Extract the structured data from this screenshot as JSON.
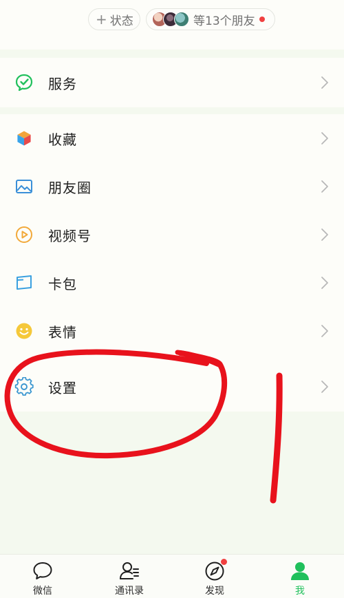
{
  "header": {
    "status_button": {
      "label": "状态"
    },
    "friends_pill": {
      "label": "等13个朋友"
    }
  },
  "menu": {
    "service": {
      "label": "服务",
      "icon": "service-icon"
    },
    "items": [
      {
        "label": "收藏",
        "icon": "favorites-cube-icon"
      },
      {
        "label": "朋友圈",
        "icon": "moments-image-icon"
      },
      {
        "label": "视频号",
        "icon": "channels-play-icon"
      },
      {
        "label": "卡包",
        "icon": "card-wallet-icon"
      },
      {
        "label": "表情",
        "icon": "emoji-smile-icon"
      },
      {
        "label": "设置",
        "icon": "settings-gear-icon"
      }
    ]
  },
  "tabbar": {
    "tabs": [
      {
        "label": "微信",
        "icon": "chat-bubble-icon"
      },
      {
        "label": "通讯录",
        "icon": "contacts-icon"
      },
      {
        "label": "发现",
        "icon": "compass-icon"
      },
      {
        "label": "我",
        "icon": "person-icon"
      }
    ],
    "active_index": 3
  },
  "colors": {
    "accent": "#20c05c",
    "badge": "#f04040",
    "annotation": "#e8121c"
  }
}
